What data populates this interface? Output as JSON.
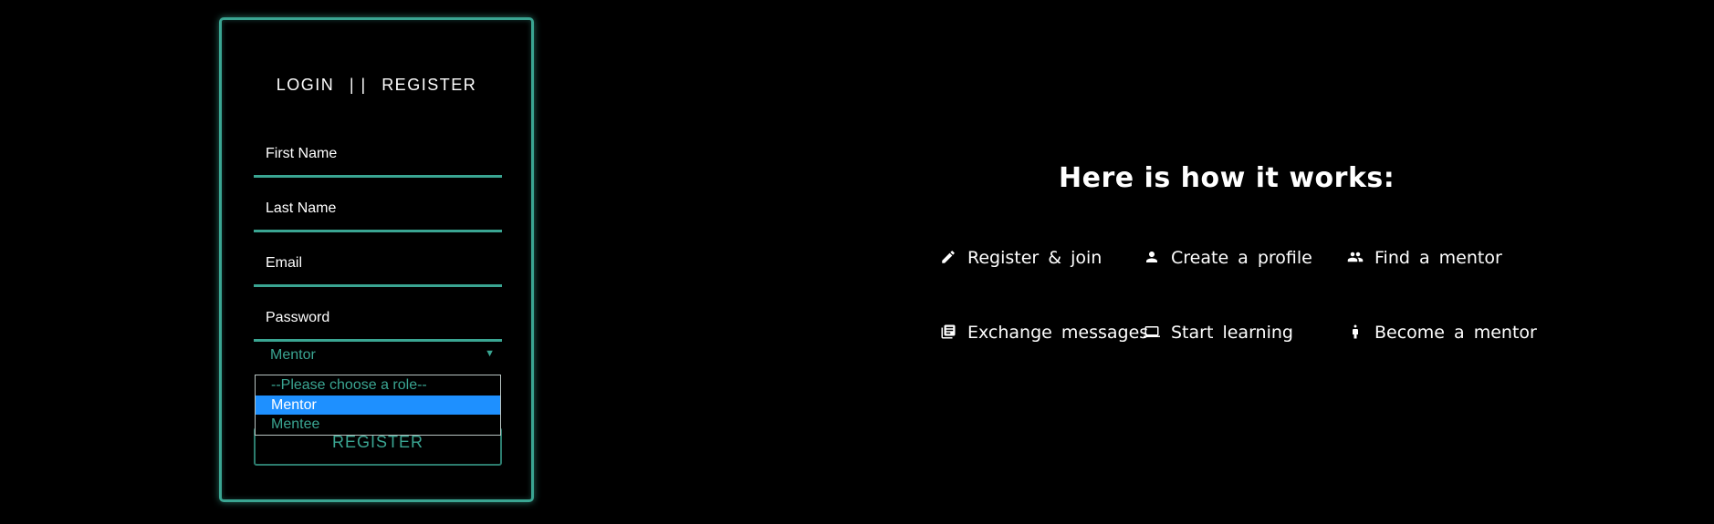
{
  "form": {
    "login_tab": "LOGIN",
    "separator": "| |",
    "register_tab": "REGISTER",
    "first_name_placeholder": "First Name",
    "last_name_placeholder": "Last Name",
    "email_placeholder": "Email",
    "password_placeholder": "Password",
    "role_select": {
      "selected": "Mentor",
      "options": [
        "--Please choose a role--",
        "Mentor",
        "Mentee"
      ],
      "highlighted_index": 1
    },
    "register_button": "REGISTER"
  },
  "how_it_works": {
    "title": "Here is how it works:",
    "steps": [
      {
        "label": "Register & join",
        "icon": "pencil-icon"
      },
      {
        "label": "Create a profile",
        "icon": "person-icon"
      },
      {
        "label": "Find a mentor",
        "icon": "people-icon"
      },
      {
        "label": "Exchange messages",
        "icon": "messages-icon"
      },
      {
        "label": "Start learning",
        "icon": "laptop-icon"
      },
      {
        "label": "Become a mentor",
        "icon": "standing-person-icon"
      }
    ]
  },
  "colors": {
    "background": "#000000",
    "accent": "#3aa592",
    "highlight": "#1e90ff",
    "text": "#ffffff"
  }
}
